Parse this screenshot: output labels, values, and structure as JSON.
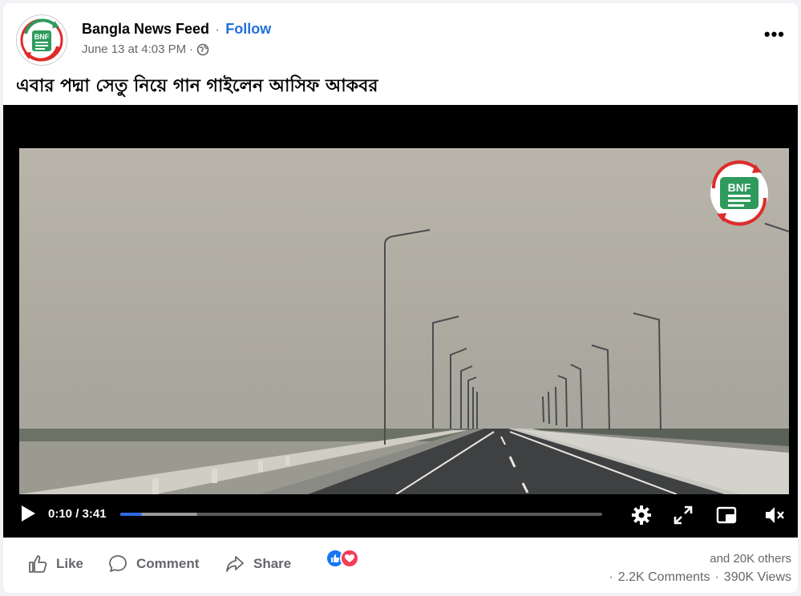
{
  "post": {
    "page_name": "Bangla News Feed",
    "separator": "·",
    "follow_label": "Follow",
    "timestamp": "June 13 at 4:03 PM",
    "timestamp_sep": "·",
    "privacy_icon": "globe-icon",
    "more_icon": "more-options-icon",
    "caption": "এবার পদ্মা সেতু নিয়ে গান গাইলেন আসিফ আকবর",
    "logo_text": "BNF"
  },
  "video": {
    "current_time": "0:10",
    "time_sep": " / ",
    "duration": "3:41",
    "progress_fraction": 0.045,
    "buffered_fraction": 0.16,
    "watermark_text": "BNF",
    "controls": [
      "play-icon",
      "settings-icon",
      "fullscreen-icon",
      "miniplayer-icon",
      "mute-icon"
    ]
  },
  "actions": {
    "like_label": "Like",
    "comment_label": "Comment",
    "share_label": "Share"
  },
  "stats": {
    "reactions_text": "and 20K others",
    "comments_text": "2.2K Comments",
    "views_text": "390K Views",
    "dot": "·"
  },
  "colors": {
    "link_blue": "#216fdb",
    "progress_blue": "#2d6be0",
    "like_blue": "#1877f2",
    "love_red": "#f33e58",
    "brand_green": "#2e9b5d",
    "brand_red": "#e02a2a"
  }
}
